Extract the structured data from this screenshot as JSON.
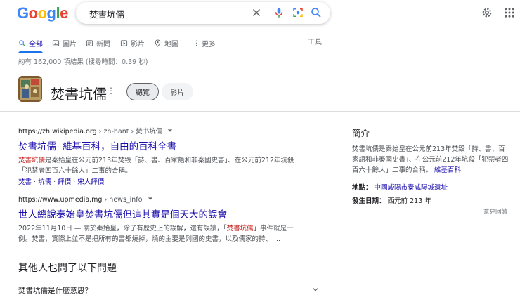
{
  "logo": {
    "letters": [
      "G",
      "o",
      "o",
      "g",
      "l",
      "e"
    ],
    "colors": [
      "#4285F4",
      "#EA4335",
      "#FBBC05",
      "#4285F4",
      "#34A853",
      "#EA4335"
    ]
  },
  "search": {
    "query": "焚書坑儒"
  },
  "tabs": [
    {
      "label": "全部",
      "icon": "search-icon",
      "active": true
    },
    {
      "label": "圖片",
      "icon": "image-icon"
    },
    {
      "label": "新聞",
      "icon": "news-icon"
    },
    {
      "label": "影片",
      "icon": "video-icon"
    },
    {
      "label": "地圖",
      "icon": "map-pin-icon"
    },
    {
      "label": "更多",
      "icon": "more-dots-icon"
    }
  ],
  "tools_label": "工具",
  "result_stats": "約有 162,000 項結果 (搜尋時間：0.39 秒)",
  "entity": {
    "title": "焚書坑儒",
    "more": "⋮",
    "chips": [
      "總覽",
      "影片"
    ]
  },
  "results": [
    {
      "site": "https://zh.wikipedia.org",
      "path": " › zh-hant › 焚书坑儒",
      "title": "焚書坑儒- 維基百科，自由的百科全書",
      "snippet_hl": "焚書坑儒",
      "snippet_line1_rest": "是秦始皇在公元前213年焚毀「詩、書、百家語和非秦國史書」、在公元前212年坑殺",
      "snippet_line2": "「犯禁者四百六十餘人」二事的合稱。",
      "links": [
        "焚書",
        "坑儒",
        "評價",
        "宋人評價"
      ]
    },
    {
      "site": "https://www.upmedia.mg",
      "path": " › news_info",
      "title": "世人總說秦始皇焚書坑儒但這其實是個天大的誤會",
      "snippet_line1_pre": "2022年11月10日 — 關於秦始皇，除了有歷史上的誤解，還有誤讀，「",
      "snippet_hl": "焚書坑儒",
      "snippet_line1_post": "」事件就是一",
      "snippet_line2": "例。焚書，實際上並不是把所有的書都燒掉，燒的主要是列國的史書，以及儒家的詩、 ..."
    }
  ],
  "paa": {
    "title": "其他人也問了以下問題",
    "question": "焚書坑儒是什麼意思？"
  },
  "knowledge_panel": {
    "heading": "簡介",
    "description": "焚書坑儒是秦始皇在公元前213年焚毀「詩、書、百家語和非秦國史書」、在公元前212年坑殺「犯禁者四百六十餘人」二事的合稱。",
    "source_link": "維基百科",
    "facts": [
      {
        "label": "地點：",
        "value": "中國咸陽市秦咸陽城遺址",
        "link": true
      },
      {
        "label": "發生日期：",
        "value": "西元前 213 年",
        "link": false
      }
    ],
    "feedback": "意見回饋"
  }
}
